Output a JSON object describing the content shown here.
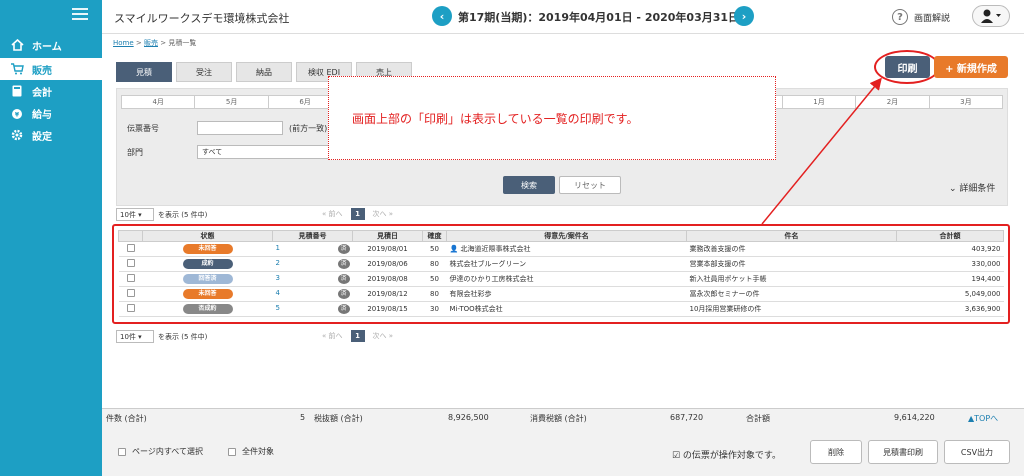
{
  "app": {
    "company": "スマイルワークスデモ環境株式会社",
    "period": "第17期(当期)：2019年04月01日 - 2020年03月31日",
    "help_label": "画面解説"
  },
  "nav": [
    {
      "label": "ホーム",
      "icon": "home-icon"
    },
    {
      "label": "販売",
      "icon": "cart-icon"
    },
    {
      "label": "会計",
      "icon": "calculator-icon"
    },
    {
      "label": "給与",
      "icon": "money-bag-icon"
    },
    {
      "label": "設定",
      "icon": "gear-icon"
    }
  ],
  "breadcrumb": {
    "home": "Home",
    "sales": "販売",
    "current": "見積一覧"
  },
  "tabs": [
    "見積",
    "受注",
    "納品",
    "検収 EDI",
    "売上"
  ],
  "actions": {
    "print": "印刷",
    "new": "+ 新規作成"
  },
  "search": {
    "months": [
      "4月",
      "5月",
      "6月",
      "",
      "",
      "",
      "",
      "",
      "",
      "1月",
      "2月",
      "3月"
    ],
    "slip_label": "伝票番号",
    "slip_suffix": "(前方一致)",
    "dept_label": "部門",
    "dept_value": "すべて",
    "search_btn": "検索",
    "reset_btn": "リセット",
    "detail": "詳細条件"
  },
  "callout": "画面上部の「印刷」は表示している一覧の印刷です。",
  "pager": {
    "per_page": "10件",
    "count": "を表示 (5 件中)",
    "prev": "« 前へ",
    "page": "1",
    "next": "次へ »"
  },
  "table": {
    "headers": [
      "",
      "状態",
      "見積番号",
      "見積日",
      "確度",
      "得意先/案件名",
      "件名",
      "合計額"
    ],
    "rows": [
      {
        "status": "未回答",
        "color": "#e87a2a",
        "no": "1",
        "date": "2019/08/01",
        "prob": "50",
        "client": "北海道近際事株式会社",
        "subject": "業務改善支援の件",
        "total": "403,920"
      },
      {
        "status": "成約",
        "color": "#4a5f78",
        "no": "2",
        "date": "2019/08/06",
        "prob": "80",
        "client": "株式会社ブルーグリーン",
        "subject": "営業本部支援の件",
        "total": "330,000"
      },
      {
        "status": "回答済",
        "color": "#9fb8d6",
        "no": "3",
        "date": "2019/08/08",
        "prob": "50",
        "client": "伊達のひかり工房株式会社",
        "subject": "新入社員用ポケット手帳",
        "total": "194,400"
      },
      {
        "status": "未回答",
        "color": "#e87a2a",
        "no": "4",
        "date": "2019/08/12",
        "prob": "80",
        "client": "有限会社彩歩",
        "subject": "冨永次郎セミナーの件",
        "total": "5,049,000"
      },
      {
        "status": "否成約",
        "color": "#888888",
        "no": "5",
        "date": "2019/08/15",
        "prob": "30",
        "client": "Mi-TOO株式会社",
        "subject": "10月採用営業研修の件",
        "total": "3,636,900"
      }
    ],
    "sumi": "済"
  },
  "totals": {
    "count_label": "件数 (合計)",
    "count": "5",
    "tax_ex_label": "税抜額 (合計)",
    "tax_ex": "8,926,500",
    "tax_label": "消費税額 (合計)",
    "tax": "687,720",
    "sum_label": "合計額",
    "sum": "9,614,220",
    "top": "▲TOPへ"
  },
  "footer": {
    "select_page": "ページ内すべて選択",
    "select_all": "全件対象",
    "target": "☑ の伝票が操作対象です。",
    "delete": "削除",
    "print_quote": "見積書印刷",
    "csv": "CSV出力"
  }
}
